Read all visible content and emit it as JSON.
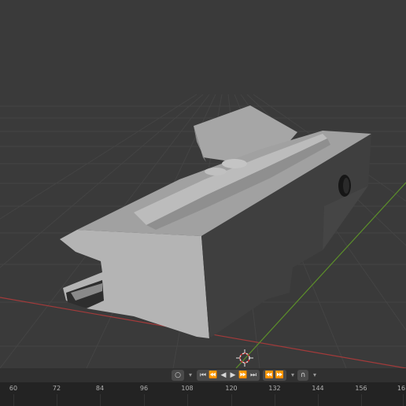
{
  "timeline": {
    "controls": {
      "record_icon": "record-icon",
      "dropdown_icon": "chevron-down-icon",
      "jump_start_icon": "jump-start-icon",
      "prev_keyframe_icon": "prev-keyframe-icon",
      "play_reverse_icon": "play-reverse-icon",
      "play_icon": "play-icon",
      "next_keyframe_icon": "next-keyframe-icon",
      "jump_end_icon": "jump-end-icon",
      "keying_prev_icon": "keying-prev-icon",
      "keying_next_icon": "keying-next-icon",
      "snap_icon": "snap-icon"
    },
    "ruler_labels": [
      "60",
      "72",
      "84",
      "96",
      "108",
      "120",
      "132",
      "144",
      "156",
      "16"
    ]
  },
  "viewport": {
    "axis_colors": {
      "x": "#a33a3a",
      "y": "#5c8f2a"
    },
    "cursor_icon": "3d-cursor-icon",
    "object": "mesh-part"
  }
}
